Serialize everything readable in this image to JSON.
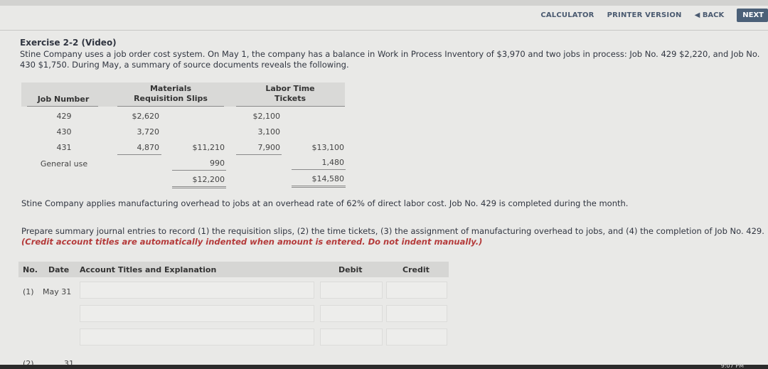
{
  "toolbar": {
    "calculator": "CALCULATOR",
    "printer": "PRINTER VERSION",
    "back": "BACK",
    "next": "NEXT"
  },
  "exercise": {
    "title": "Exercise 2-2 (Video)",
    "intro": "Stine Company uses a job order cost system. On May 1, the company has a balance in Work in Process Inventory of $3,970 and two jobs in process: Job No. 429 $2,220, and Job No. 430 $1,750. During May, a summary of source documents reveals the following."
  },
  "source_table": {
    "headers": {
      "job_number": "Job Number",
      "materials_line1": "Materials",
      "materials_line2": "Requisition Slips",
      "labor_line1": "Labor Time",
      "labor_line2": "Tickets"
    },
    "rows": [
      {
        "job": "429",
        "materials": "$2,620",
        "labor": "$2,100"
      },
      {
        "job": "430",
        "materials": "3,720",
        "labor": "3,100"
      },
      {
        "job": "431",
        "materials": "4,870",
        "materials_sub": "$11,210",
        "labor": "7,900",
        "labor_sub": "$13,100"
      },
      {
        "job": "General use",
        "materials_sub": "990",
        "labor_sub": "1,480"
      }
    ],
    "totals": {
      "materials": "$12,200",
      "labor": "$14,580"
    }
  },
  "overhead_text": "Stine Company applies manufacturing overhead to jobs at an overhead rate of 62% of direct labor cost. Job No. 429 is completed during the month.",
  "prepare": {
    "text": "Prepare summary journal entries to record (1) the requisition slips, (2) the time tickets, (3) the assignment of manufacturing overhead to jobs, and (4) the completion of Job No. 429.",
    "note": "(Credit account titles are automatically indented when amount is entered. Do not indent manually.)"
  },
  "journal": {
    "headers": {
      "no": "No.",
      "date": "Date",
      "account": "Account Titles and Explanation",
      "debit": "Debit",
      "credit": "Credit"
    },
    "entries": [
      {
        "no": "(1)",
        "date": "May 31"
      },
      {
        "no": "(2)",
        "date": "31"
      }
    ]
  },
  "taskbar": {
    "clock": "9:07 PM"
  }
}
